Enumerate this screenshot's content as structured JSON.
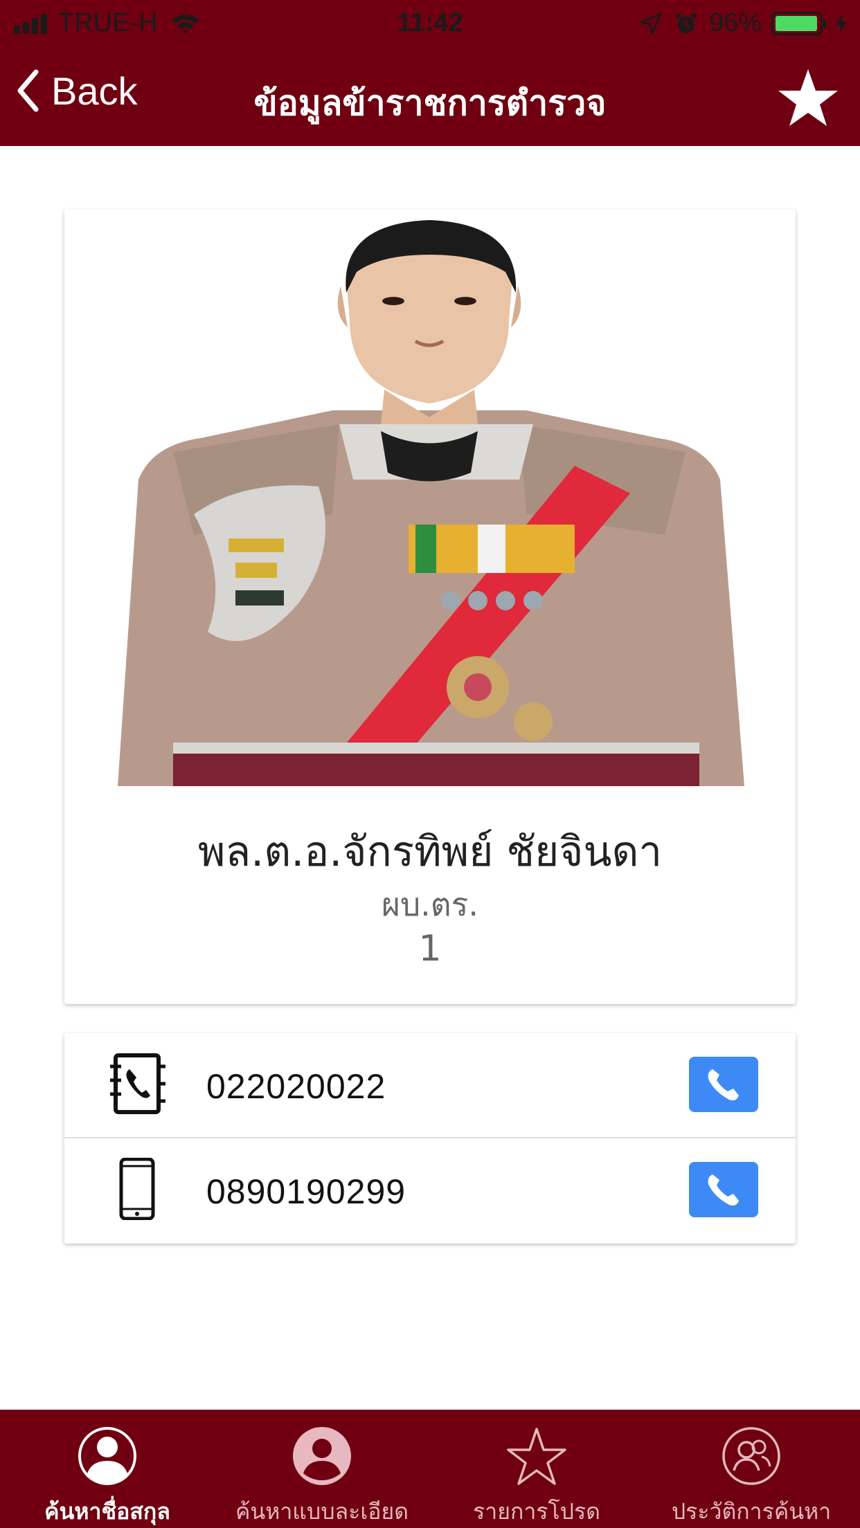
{
  "status_bar": {
    "carrier": "TRUE-H",
    "time": "11:42",
    "battery": "96%",
    "battery_level": 0.96
  },
  "nav": {
    "back_label": "Back",
    "title": "ข้อมูลข้าราชการตำรวจ",
    "favorite_icon": "star-icon"
  },
  "profile": {
    "name": "พล.ต.อ.จักรทิพย์ ชัยจินดา",
    "position": "ผบ.ตร.",
    "level": "1"
  },
  "phones": [
    {
      "type": "office",
      "icon": "phone-book-icon",
      "number": "022020022"
    },
    {
      "type": "mobile",
      "icon": "mobile-phone-icon",
      "number": "0890190299"
    }
  ],
  "tabs": [
    {
      "label": "ค้นหาชื่อสกุล",
      "icon": "person-circle-icon",
      "active": true
    },
    {
      "label": "ค้นหาแบบละเอียด",
      "icon": "account-circle-icon",
      "active": false
    },
    {
      "label": "รายการโปรด",
      "icon": "star-outline-icon",
      "active": false
    },
    {
      "label": "ประวัติการค้นหา",
      "icon": "history-people-icon",
      "active": false
    }
  ],
  "colors": {
    "primary": "#700011",
    "call_button": "#3d8af7",
    "battery": "#4cd964"
  }
}
